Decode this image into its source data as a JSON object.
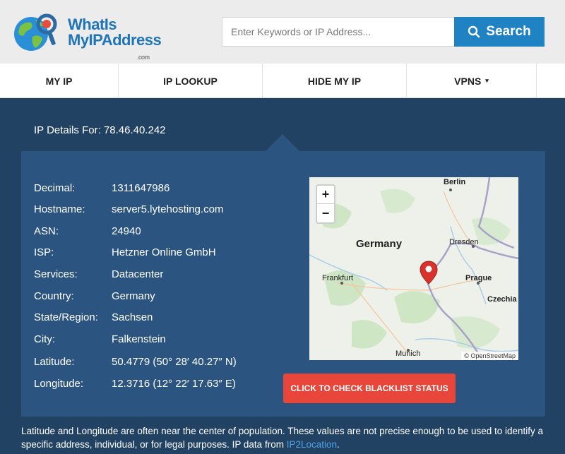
{
  "header": {
    "logo_line1": "WhatIs",
    "logo_line2": "MyIPAddress",
    "logo_suffix": ".com",
    "search_placeholder": "Enter Keywords or IP Address...",
    "search_button": "Search"
  },
  "nav": {
    "items": [
      {
        "label": "MY IP"
      },
      {
        "label": "IP LOOKUP"
      },
      {
        "label": "HIDE MY IP"
      },
      {
        "label": "VPNS"
      }
    ],
    "vpns_caret": "▾"
  },
  "main": {
    "heading": "IP Details For: 78.46.40.242",
    "details": [
      {
        "label": "Decimal:",
        "value": "1311647986"
      },
      {
        "label": "Hostname:",
        "value": "server5.lytehosting.com"
      },
      {
        "label": "ASN:",
        "value": "24940"
      },
      {
        "label": "ISP:",
        "value": "Hetzner Online GmbH"
      },
      {
        "label": "Services:",
        "value": "Datacenter"
      },
      {
        "label": "Country:",
        "value": "Germany"
      },
      {
        "label": "State/Region:",
        "value": "Sachsen"
      },
      {
        "label": "City:",
        "value": "Falkenstein"
      },
      {
        "label": "Latitude:",
        "value": "50.4779  (50° 28′ 40.27″ N)"
      },
      {
        "label": "Longitude:",
        "value": "12.3716  (12° 22′ 17.63″ E)"
      }
    ],
    "blacklist_button": "CLICK TO CHECK BLACKLIST STATUS"
  },
  "map": {
    "zoom_in": "+",
    "zoom_out": "−",
    "attribution": "© OpenStreetMap",
    "labels": {
      "berlin": "Berlin",
      "germany": "Germany",
      "dresden": "Dresden",
      "frankfurt": "Frankfurt",
      "prague": "Prague",
      "czechia": "Czechia",
      "munich": "Munich"
    }
  },
  "footer": {
    "note": "Latitude and Longitude are often near the center of population. These values are not precise enough to be used to identify a specific address, individual, or for legal purposes. IP data from ",
    "link": "IP2Location",
    "period": "."
  },
  "colors": {
    "background": "#224263",
    "panel": "#2b5580",
    "accent_blue": "#1f82c2",
    "button_red": "#e8463a",
    "marker_red": "#d8322a"
  }
}
